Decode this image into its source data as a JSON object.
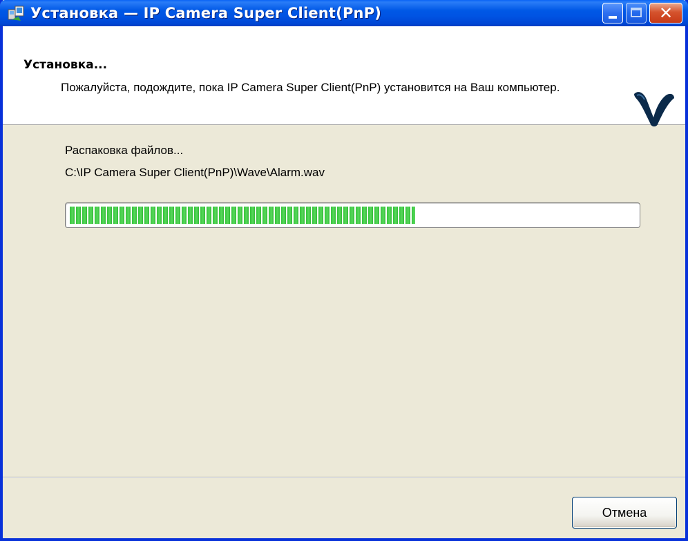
{
  "window": {
    "title": "Установка — IP Camera Super Client(PnP)",
    "buttons": {
      "close_glyph": "✕"
    }
  },
  "header": {
    "title": "Установка...",
    "subtitle": "Пожалуйста, подождите, пока IP Camera Super Client(PnP) установится на Ваш компьютер.",
    "logo_icon": "installer-logo-icon"
  },
  "body": {
    "status": "Распаковка файлов...",
    "file_path": "C:\\IP Camera Super Client(PnP)\\Wave\\Alarm.wav",
    "progress_fraction": 0.61,
    "progress_color": "#34c43a"
  },
  "footer": {
    "cancel_label": "Отмена"
  }
}
